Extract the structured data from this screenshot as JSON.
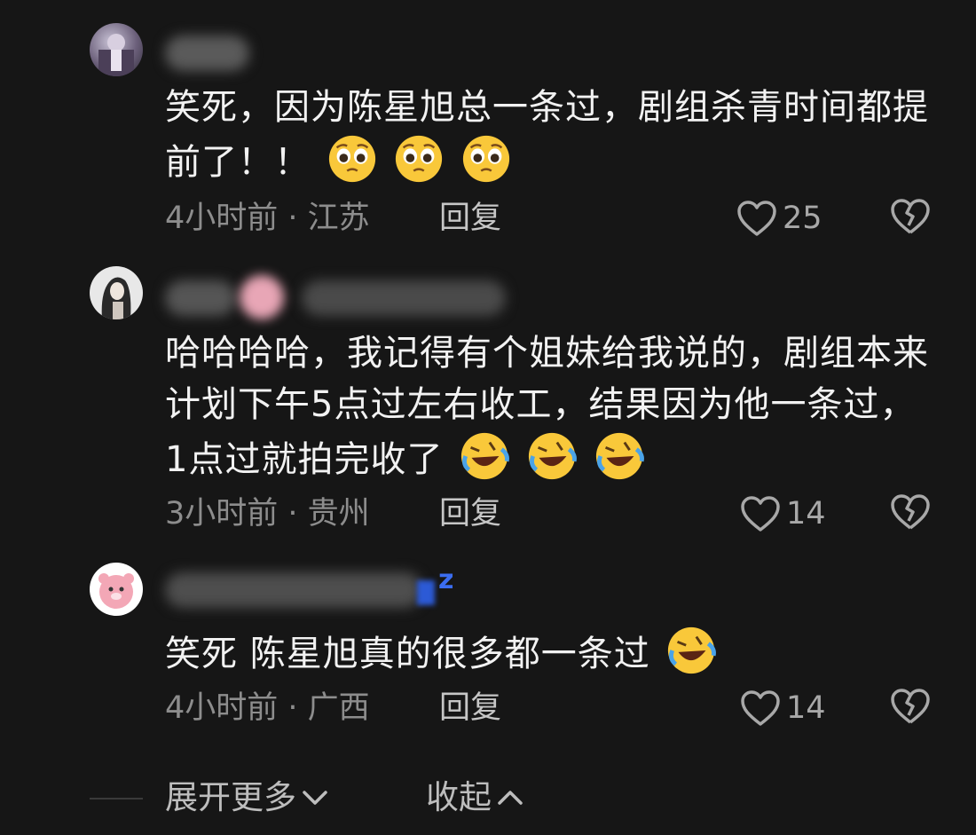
{
  "comments": [
    {
      "text": "笑死，因为陈星旭总一条过，剧组杀青时间都提前了！！",
      "emojis": [
        "pleading-face",
        "pleading-face",
        "pleading-face"
      ],
      "time": "4小时前",
      "location": "江苏",
      "reply_label": "回复",
      "likes": "25"
    },
    {
      "text": "哈哈哈哈，我记得有个姐妹给我说的，剧组本来计划下午5点过左右收工，结果因为他一条过，1点过就拍完收了",
      "emojis": [
        "rolling-laugh",
        "rolling-laugh",
        "rolling-laugh"
      ],
      "time": "3小时前",
      "location": "贵州",
      "reply_label": "回复",
      "likes": "14"
    },
    {
      "text": "笑死 陈星旭真的很多都一条过",
      "emojis": [
        "rolling-laugh"
      ],
      "time": "4小时前",
      "location": "广西",
      "reply_label": "回复",
      "likes": "14"
    }
  ],
  "meta_separator": " · ",
  "footer": {
    "expand_label": "展开更多",
    "collapse_label": "收起"
  },
  "colors": {
    "background": "#161616",
    "text": "#f2f2f2",
    "meta": "#8d8d8d",
    "icon": "#a8a8a8"
  }
}
